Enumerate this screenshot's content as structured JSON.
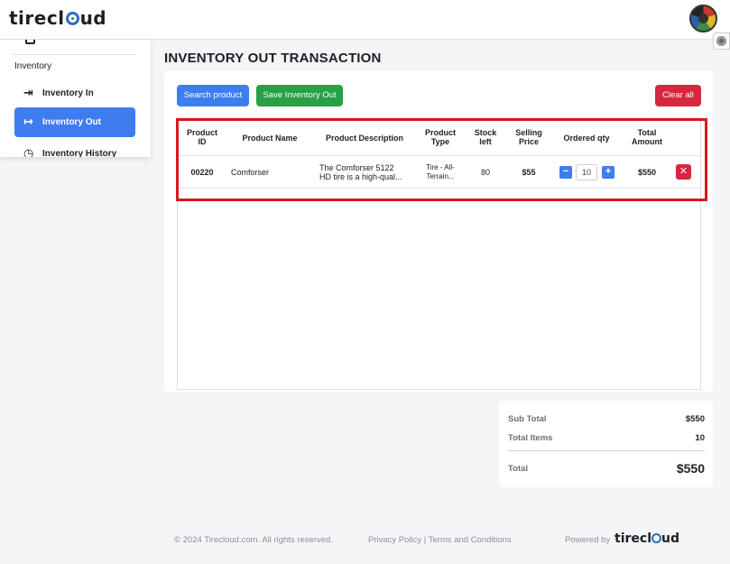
{
  "header": {
    "logo_pre": "tirecl",
    "logo_post": "ud"
  },
  "sidebar": {
    "section_label": "Inventory",
    "items": [
      {
        "label": "Inventory In",
        "icon": "sign-in-icon"
      },
      {
        "label": "Inventory Out",
        "icon": "sign-out-icon",
        "active": true
      },
      {
        "label": "Inventory History",
        "icon": "history-icon"
      }
    ]
  },
  "page": {
    "title": "INVENTORY OUT TRANSACTION"
  },
  "toolbar": {
    "search_label": "Search product",
    "save_label": "Save Inventory Out",
    "clear_label": "Clear all"
  },
  "table": {
    "headers": {
      "product_id": "Product ID",
      "product_name": "Product Name",
      "description": "Product Description",
      "type": "Product Type",
      "stock_left": "Stock left",
      "selling_price": "Selling Price",
      "ordered_qty": "Ordered qty",
      "total_amount": "Total Amount"
    },
    "rows": [
      {
        "product_id": "00220",
        "product_name": "Comforser",
        "description_line1": "The Comforser 5122",
        "description_line2": "HD tire is a high-qual...",
        "type_line1": "Tire - All-",
        "type_line2": "Terrain...",
        "stock_left": "80",
        "selling_price": "$55",
        "qty_minus": "−",
        "ordered_qty": "10",
        "qty_plus": "+",
        "total_amount": "$550",
        "delete_symbol": "✕"
      }
    ]
  },
  "summary": {
    "subtotal_label": "Sub Total",
    "subtotal_value": "$550",
    "items_label": "Total Items",
    "items_value": "10",
    "total_label": "Total",
    "total_value": "$550"
  },
  "footer": {
    "copyright": "© 2024 Tirecloud.com. All rights reserved.",
    "links": "Privacy Policy | Terms and Conditions",
    "powered_by": "Powered by",
    "logo_pre": "tirecl",
    "logo_post": "ud"
  },
  "colors": {
    "primary": "#3d7df0",
    "success": "#27a046",
    "danger": "#d7263d",
    "highlight": "#d71920"
  }
}
